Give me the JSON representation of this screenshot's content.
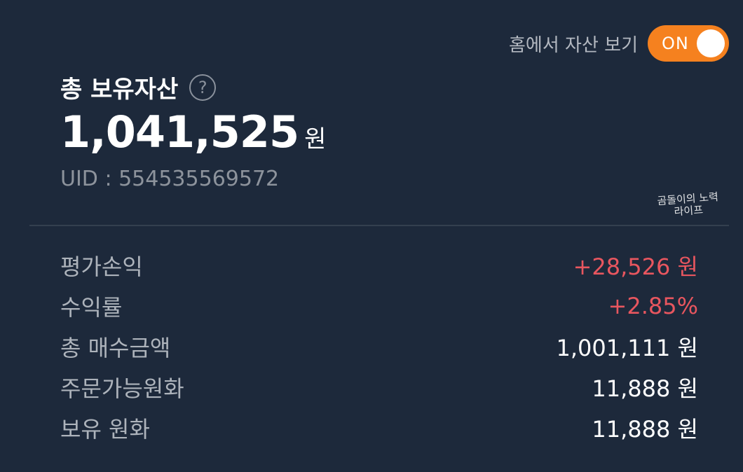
{
  "home_toggle": {
    "label": "홈에서 자산 보기",
    "state_text": "ON",
    "on": true
  },
  "total": {
    "title": "총 보유자산",
    "help_symbol": "?",
    "amount": "1,041,525",
    "unit": "원",
    "uid": "UID : 554535569572"
  },
  "watermark": {
    "line1": "곰돌이의 노력",
    "line2": "라이프"
  },
  "rows": [
    {
      "label": "평가손익",
      "value": "+28,526 원",
      "tone": "positive"
    },
    {
      "label": "수익률",
      "value": "+2.85%",
      "tone": "positive"
    },
    {
      "label": "총 매수금액",
      "value": "1,001,111 원",
      "tone": "neutral"
    },
    {
      "label": "주문가능원화",
      "value": "11,888 원",
      "tone": "neutral"
    },
    {
      "label": "보유 원화",
      "value": "11,888 원",
      "tone": "neutral"
    }
  ],
  "colors": {
    "background": "#1d293b",
    "accent_orange": "#f5811f",
    "positive_red": "#e8565f"
  }
}
